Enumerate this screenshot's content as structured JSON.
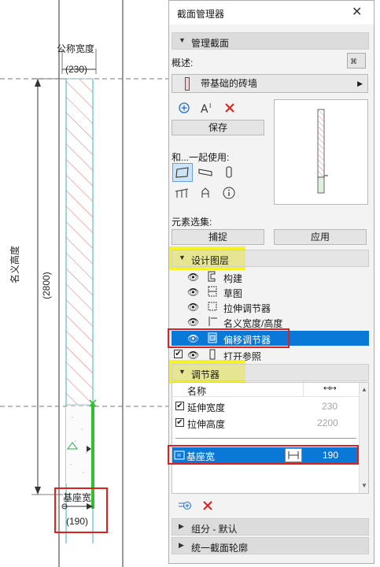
{
  "drawing": {
    "nominal_width_label": "公称宽度",
    "nominal_width_value": "(230)",
    "nominal_height_label": "名义高度",
    "nominal_height_value": "(2800)",
    "base_width_label": "基座宽",
    "base_width_value": "(190)"
  },
  "panel": {
    "title": "截面管理器",
    "close_glyph": "✕",
    "section_manage": "管理截面",
    "desc_label": "概述:",
    "profile_name": "带基础的砖墙",
    "save_label": "保存",
    "use_with_label": "和...一起使用:",
    "element_set_label": "元素选集:",
    "capture_label": "捕捉",
    "apply_label": "应用",
    "section_layers": "设计图层",
    "layers": [
      {
        "name": "构建"
      },
      {
        "name": "草图"
      },
      {
        "name": "拉伸调节器"
      },
      {
        "name": "名义宽度/高度"
      },
      {
        "name": "偏移调节器"
      },
      {
        "name": "打开参照"
      }
    ],
    "section_modifiers": "调节器",
    "table_header_name": "名称",
    "table_header_icon": "↤↦",
    "rows": [
      {
        "name": "延伸宽度",
        "value": "230"
      },
      {
        "name": "拉伸高度",
        "value": "2200"
      }
    ],
    "selected_row": {
      "name": "基座宽",
      "value": "190"
    },
    "section_group": "组分 - 默认",
    "section_unify": "统一截面轮廓"
  },
  "colors": {
    "selection_blue": "#0a78d7",
    "highlight_red": "#e0201c",
    "highlight_yellow": "#f5f200",
    "hatch_red": "#f07a7a",
    "modifier_green": "#2ec02e"
  }
}
